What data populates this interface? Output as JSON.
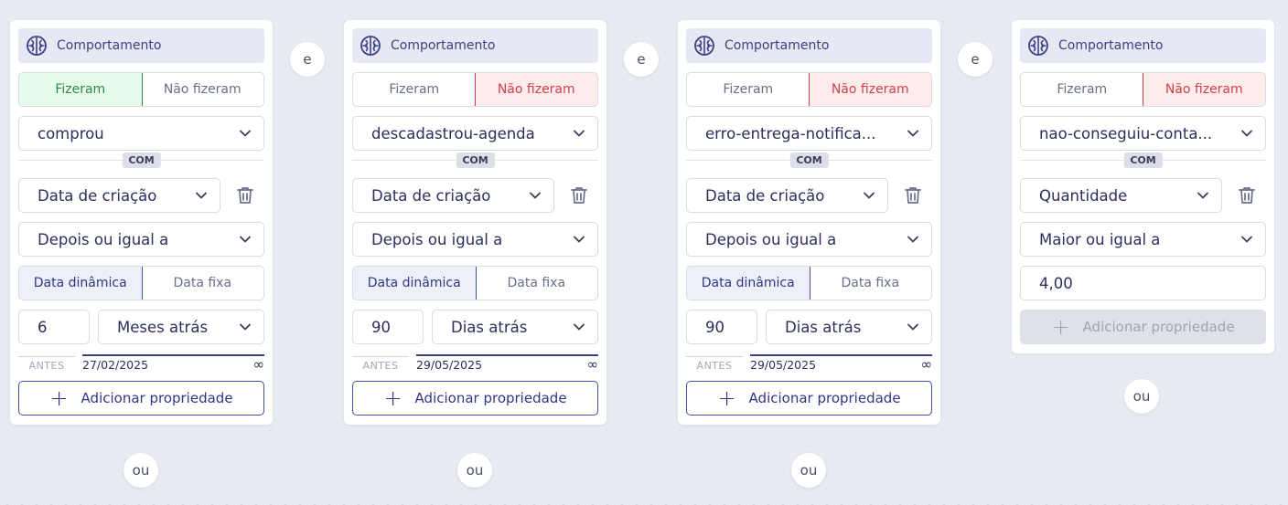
{
  "cards": [
    {
      "header": "Comportamento",
      "toggle": {
        "did": "Fizeram",
        "didnt": "Não fizeram"
      },
      "event": "comprou",
      "with": "COM",
      "property": "Data de criação",
      "operator": "Depois ou igual a",
      "date_mode": {
        "dynamic": "Data dinâmica",
        "fixed": "Data fixa"
      },
      "amount": "6",
      "unit": "Meses atrás",
      "range": {
        "before": "ANTES",
        "date": "27/02/2025",
        "inf": "∞"
      },
      "add": "Adicionar propriedade",
      "or": "ou"
    },
    {
      "header": "Comportamento",
      "toggle": {
        "did": "Fizeram",
        "didnt": "Não fizeram"
      },
      "event": "descadastrou-agenda",
      "with": "COM",
      "property": "Data de criação",
      "operator": "Depois ou igual a",
      "date_mode": {
        "dynamic": "Data dinâmica",
        "fixed": "Data fixa"
      },
      "amount": "90",
      "unit": "Dias atrás",
      "range": {
        "before": "ANTES",
        "date": "29/05/2025",
        "inf": "∞"
      },
      "add": "Adicionar propriedade",
      "or": "ou"
    },
    {
      "header": "Comportamento",
      "toggle": {
        "did": "Fizeram",
        "didnt": "Não fizeram"
      },
      "event": "erro-entrega-notifica...",
      "with": "COM",
      "property": "Data de criação",
      "operator": "Depois ou igual a",
      "date_mode": {
        "dynamic": "Data dinâmica",
        "fixed": "Data fixa"
      },
      "amount": "90",
      "unit": "Dias atrás",
      "range": {
        "before": "ANTES",
        "date": "29/05/2025",
        "inf": "∞"
      },
      "add": "Adicionar propriedade",
      "or": "ou"
    },
    {
      "header": "Comportamento",
      "toggle": {
        "did": "Fizeram",
        "didnt": "Não fizeram"
      },
      "event": "nao-conseguiu-conta...",
      "with": "COM",
      "property": "Quantidade",
      "operator": "Maior ou igual a",
      "value": "4,00",
      "add": "Adicionar propriedade",
      "or": "ou"
    }
  ],
  "and": "e",
  "colors": {
    "accent": "#3b4384",
    "did": "#2e8a45",
    "didnt": "#d43d4a"
  }
}
